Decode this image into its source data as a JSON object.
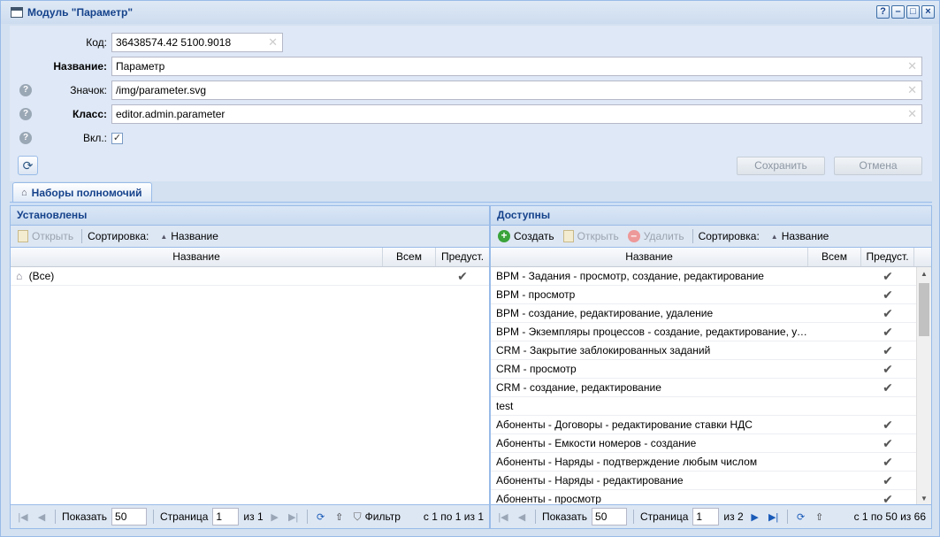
{
  "window": {
    "title": "Модуль \"Параметр\"",
    "tools": [
      "?",
      "–",
      "□",
      "×"
    ]
  },
  "form": {
    "code_label": "Код:",
    "code_value": "36438574.42 5100.9018",
    "name_label": "Название:",
    "name_value": "Параметр",
    "icon_label": "Значок:",
    "icon_value": "/img/parameter.svg",
    "class_label": "Класс:",
    "class_value": "editor.admin.parameter",
    "enabled_label": "Вкл.:",
    "save_label": "Сохранить",
    "cancel_label": "Отмена"
  },
  "tab": {
    "label": "Наборы полномочий"
  },
  "left": {
    "title": "Установлены",
    "open_label": "Открыть",
    "sort_label": "Сортировка:",
    "sort_field": "Название",
    "col_name": "Название",
    "col_all": "Всем",
    "col_pred": "Предуст.",
    "rows": [
      {
        "name": "(Все)",
        "pred": "✔"
      }
    ],
    "pager": {
      "show_label": "Показать",
      "page_size": "50",
      "page_label": "Страница",
      "page": "1",
      "of_label": "из 1",
      "filter_label": "Фильтр",
      "info": "с 1 по 1 из 1"
    }
  },
  "right": {
    "title": "Доступны",
    "create_label": "Создать",
    "open_label": "Открыть",
    "delete_label": "Удалить",
    "sort_label": "Сортировка:",
    "sort_field": "Название",
    "col_name": "Название",
    "col_all": "Всем",
    "col_pred": "Предуст.",
    "rows": [
      {
        "name": "BPM - Задания - просмотр, создание, редактирование",
        "pred": "✔"
      },
      {
        "name": "BPM - просмотр",
        "pred": "✔"
      },
      {
        "name": "BPM - создание, редактирование, удаление",
        "pred": "✔"
      },
      {
        "name": "BPM - Экземпляры процессов - создание, редактирование, удале...",
        "pred": "✔"
      },
      {
        "name": "CRM - Закрытие заблокированных заданий",
        "pred": "✔"
      },
      {
        "name": "CRM - просмотр",
        "pred": "✔"
      },
      {
        "name": "CRM - создание, редактирование",
        "pred": "✔"
      },
      {
        "name": "test",
        "pred": ""
      },
      {
        "name": "Абоненты - Договоры - редактирование ставки НДС",
        "pred": "✔"
      },
      {
        "name": "Абоненты - Емкости номеров - создание",
        "pred": "✔"
      },
      {
        "name": "Абоненты - Наряды - подтверждение любым числом",
        "pred": "✔"
      },
      {
        "name": "Абоненты - Наряды - редактирование",
        "pred": "✔"
      },
      {
        "name": "Абоненты - просмотр",
        "pred": "✔"
      }
    ],
    "pager": {
      "show_label": "Показать",
      "page_size": "50",
      "page_label": "Страница",
      "page": "1",
      "of_label": "из 2",
      "info": "с 1 по 50 из 66"
    }
  }
}
